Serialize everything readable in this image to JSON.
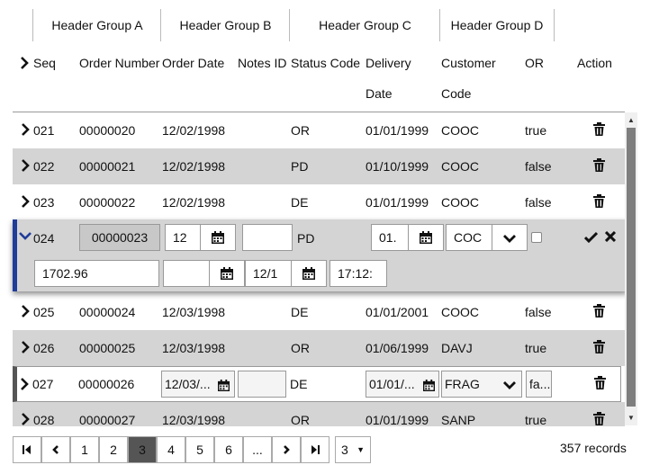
{
  "header_groups": [
    "Header Group A",
    "Header Group B",
    "Header Group C",
    "Header Group D"
  ],
  "columns": {
    "seq": "Seq",
    "order_number": "Order Number",
    "order_date": "Order Date",
    "notes_id": "Notes ID",
    "status_code": "Status Code",
    "delivery_1": "Delivery",
    "delivery_2": "Date",
    "customer_1": "Customer",
    "customer_2": "Code",
    "or": "OR",
    "action": "Action"
  },
  "rows": [
    {
      "seq": "021",
      "order_number": "00000020",
      "order_date": "12/02/1998",
      "status": "OR",
      "delivery": "01/01/1999",
      "customer": "COOC",
      "or": "true"
    },
    {
      "seq": "022",
      "order_number": "00000021",
      "order_date": "12/02/1998",
      "status": "PD",
      "delivery": "01/10/1999",
      "customer": "COOC",
      "or": "false"
    },
    {
      "seq": "023",
      "order_number": "00000022",
      "order_date": "12/02/1998",
      "status": "DE",
      "delivery": "01/01/1999",
      "customer": "COOC",
      "or": "false"
    },
    {
      "seq": "025",
      "order_number": "00000024",
      "order_date": "12/03/1998",
      "status": "DE",
      "delivery": "01/01/2001",
      "customer": "COOC",
      "or": "false"
    },
    {
      "seq": "026",
      "order_number": "00000025",
      "order_date": "12/03/1998",
      "status": "OR",
      "delivery": "01/06/1999",
      "customer": "DAVJ",
      "or": "true"
    },
    {
      "seq": "028",
      "order_number": "00000027",
      "order_date": "12/03/1998",
      "status": "OR",
      "delivery": "01/01/1999",
      "customer": "SANP",
      "or": "true"
    }
  ],
  "edit_row": {
    "seq": "024",
    "order_number": "00000023",
    "order_date": "12",
    "status": "PD",
    "delivery": "01.",
    "customer": "COC",
    "amount": "1702.96",
    "date3": "12/1",
    "time": "17:12:"
  },
  "row_027": {
    "seq": "027",
    "order_number": "00000026",
    "order_date": "12/03/...",
    "status": "DE",
    "delivery": "01/01/...",
    "customer": "FRAG",
    "or": "fa..."
  },
  "pagination": {
    "pages": [
      "1",
      "2",
      "3",
      "4",
      "5",
      "6",
      "..."
    ],
    "active": "3",
    "page_size": "3",
    "records": "357 records"
  },
  "colors": {
    "edit_accent": "#1f3c99",
    "row_gray": "#d4d4d4",
    "active_page": "#555555"
  }
}
